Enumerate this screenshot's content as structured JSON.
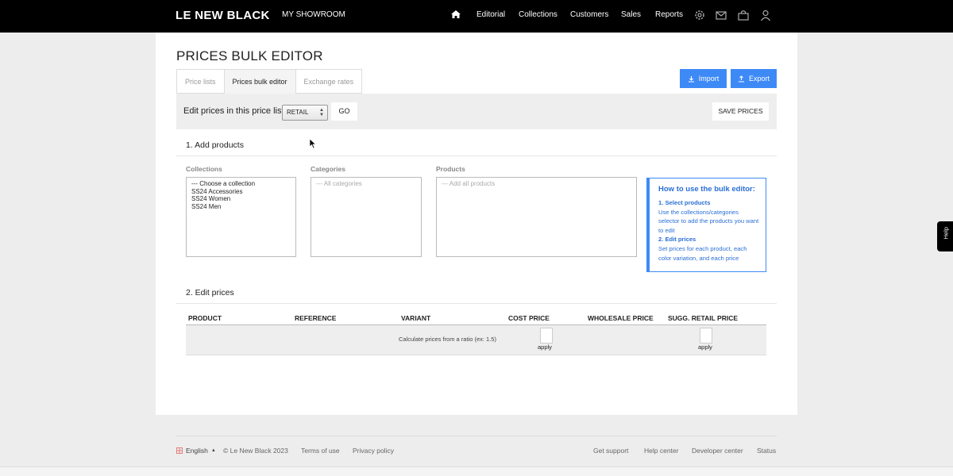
{
  "header": {
    "logo": "LE NEW BLACK",
    "showroom": "MY SHOWROOM",
    "nav": [
      "Editorial",
      "Collections",
      "Customers",
      "Sales",
      "Reports"
    ],
    "icons": [
      "home-icon",
      "settings-icon",
      "mail-icon",
      "bag-icon",
      "user-icon"
    ]
  },
  "page": {
    "title": "PRICES BULK EDITOR",
    "tabs": [
      "Price lists",
      "Prices bulk editor",
      "Exchange rates"
    ],
    "import_label": "Import",
    "export_label": "Export"
  },
  "toolbar": {
    "label": "Edit prices in this price list:",
    "price_list_selected": "RETAIL",
    "go_label": "GO",
    "save_label": "SAVE PRICES"
  },
  "add_products": {
    "title": "1. Add products",
    "collections_label": "Collections",
    "collections": [
      "--- Choose a collection",
      "SS24 Accessories",
      "SS24 Women",
      "SS24 Men"
    ],
    "categories_label": "Categories",
    "categories_placeholder": "--- All categories",
    "products_label": "Products",
    "products_placeholder": "--- Add all products"
  },
  "howto": {
    "title": "How to use the bulk editor:",
    "step1_title": "1. Select products",
    "step1_text": "Use the collections/categories selector to add the products you want to edit",
    "step2_title": "2. Edit prices",
    "step2_text": "Set prices for each product, each color variation, and each price"
  },
  "edit_prices": {
    "title": "2. Edit prices",
    "columns": [
      "PRODUCT",
      "REFERENCE",
      "VARIANT",
      "COST PRICE",
      "WHOLESALE PRICE",
      "SUGG. RETAIL PRICE"
    ],
    "ratio_label": "Calculate prices from a ratio (ex: 1.5)",
    "apply_label": "apply"
  },
  "footer": {
    "language": "English",
    "copyright": "© Le New Black 2023",
    "terms": "Terms of use",
    "privacy": "Privacy policy",
    "support": "Get support",
    "help_center": "Help center",
    "developer": "Developer center",
    "status": "Status"
  },
  "help_tab": "Help",
  "colors": {
    "accent": "#3d8af7",
    "topbar": "#000000"
  }
}
